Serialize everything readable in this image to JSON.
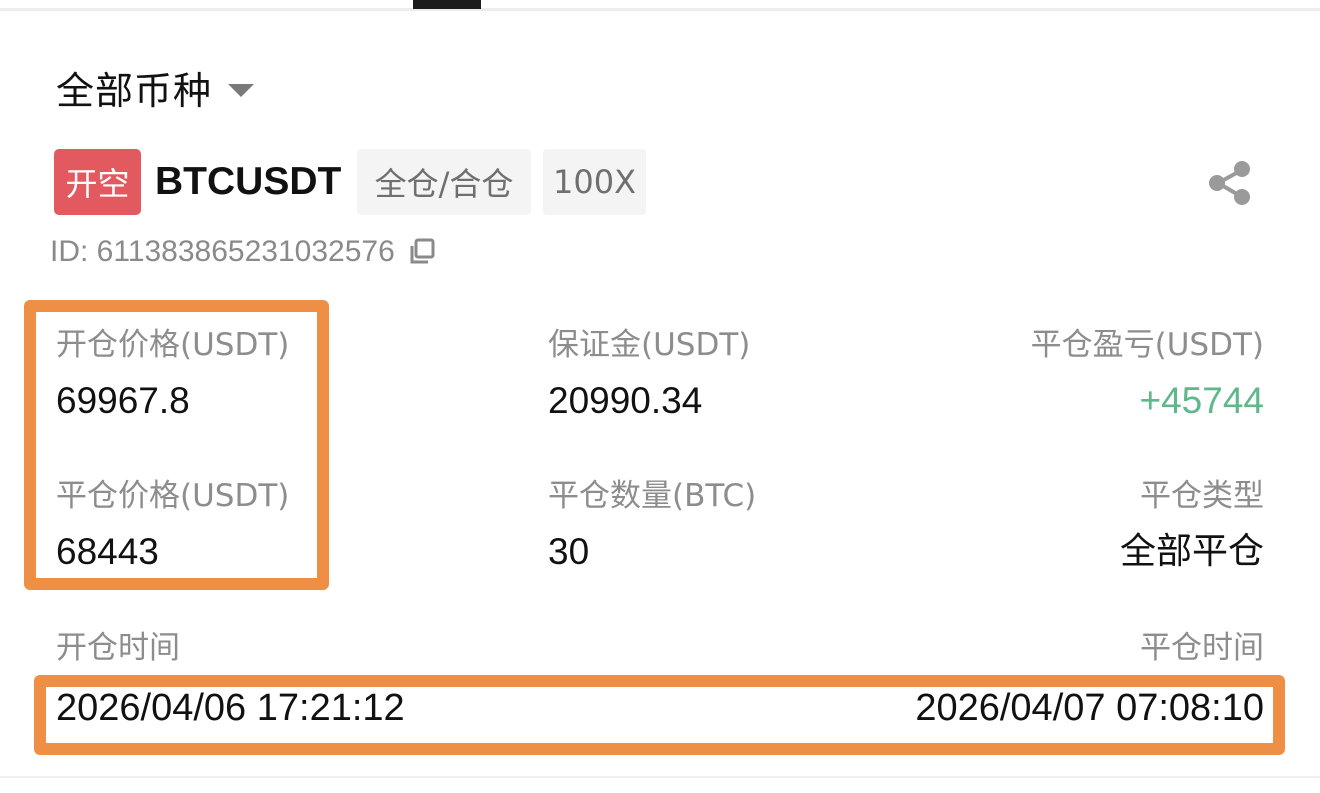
{
  "filter": {
    "label": "全部币种"
  },
  "position": {
    "side_label": "开空",
    "side_color": "#e2595f",
    "symbol": "BTCUSDT",
    "margin_mode": "全仓/合仓",
    "leverage": "100X",
    "id_text": "ID: 611383865231032576"
  },
  "stats": {
    "entry_price_label": "开仓价格(USDT)",
    "entry_price": "69967.8",
    "margin_label": "保证金(USDT)",
    "margin": "20990.34",
    "pnl_label": "平仓盈亏(USDT)",
    "pnl": "+45744",
    "pnl_color": "#5fb88c",
    "close_price_label": "平仓价格(USDT)",
    "close_price": "68443",
    "close_qty_label": "平仓数量(BTC)",
    "close_qty": "30",
    "close_type_label": "平仓类型",
    "close_type": "全部平仓"
  },
  "times": {
    "open_label": "开仓时间",
    "open_value": "2026/04/06 17:21:12",
    "close_label": "平仓时间",
    "close_value": "2026/04/07 07:08:10"
  },
  "icons": {
    "filter": "caret-down-icon",
    "share": "share-icon",
    "copy": "copy-icon"
  },
  "highlight_color": "#ef8e45"
}
